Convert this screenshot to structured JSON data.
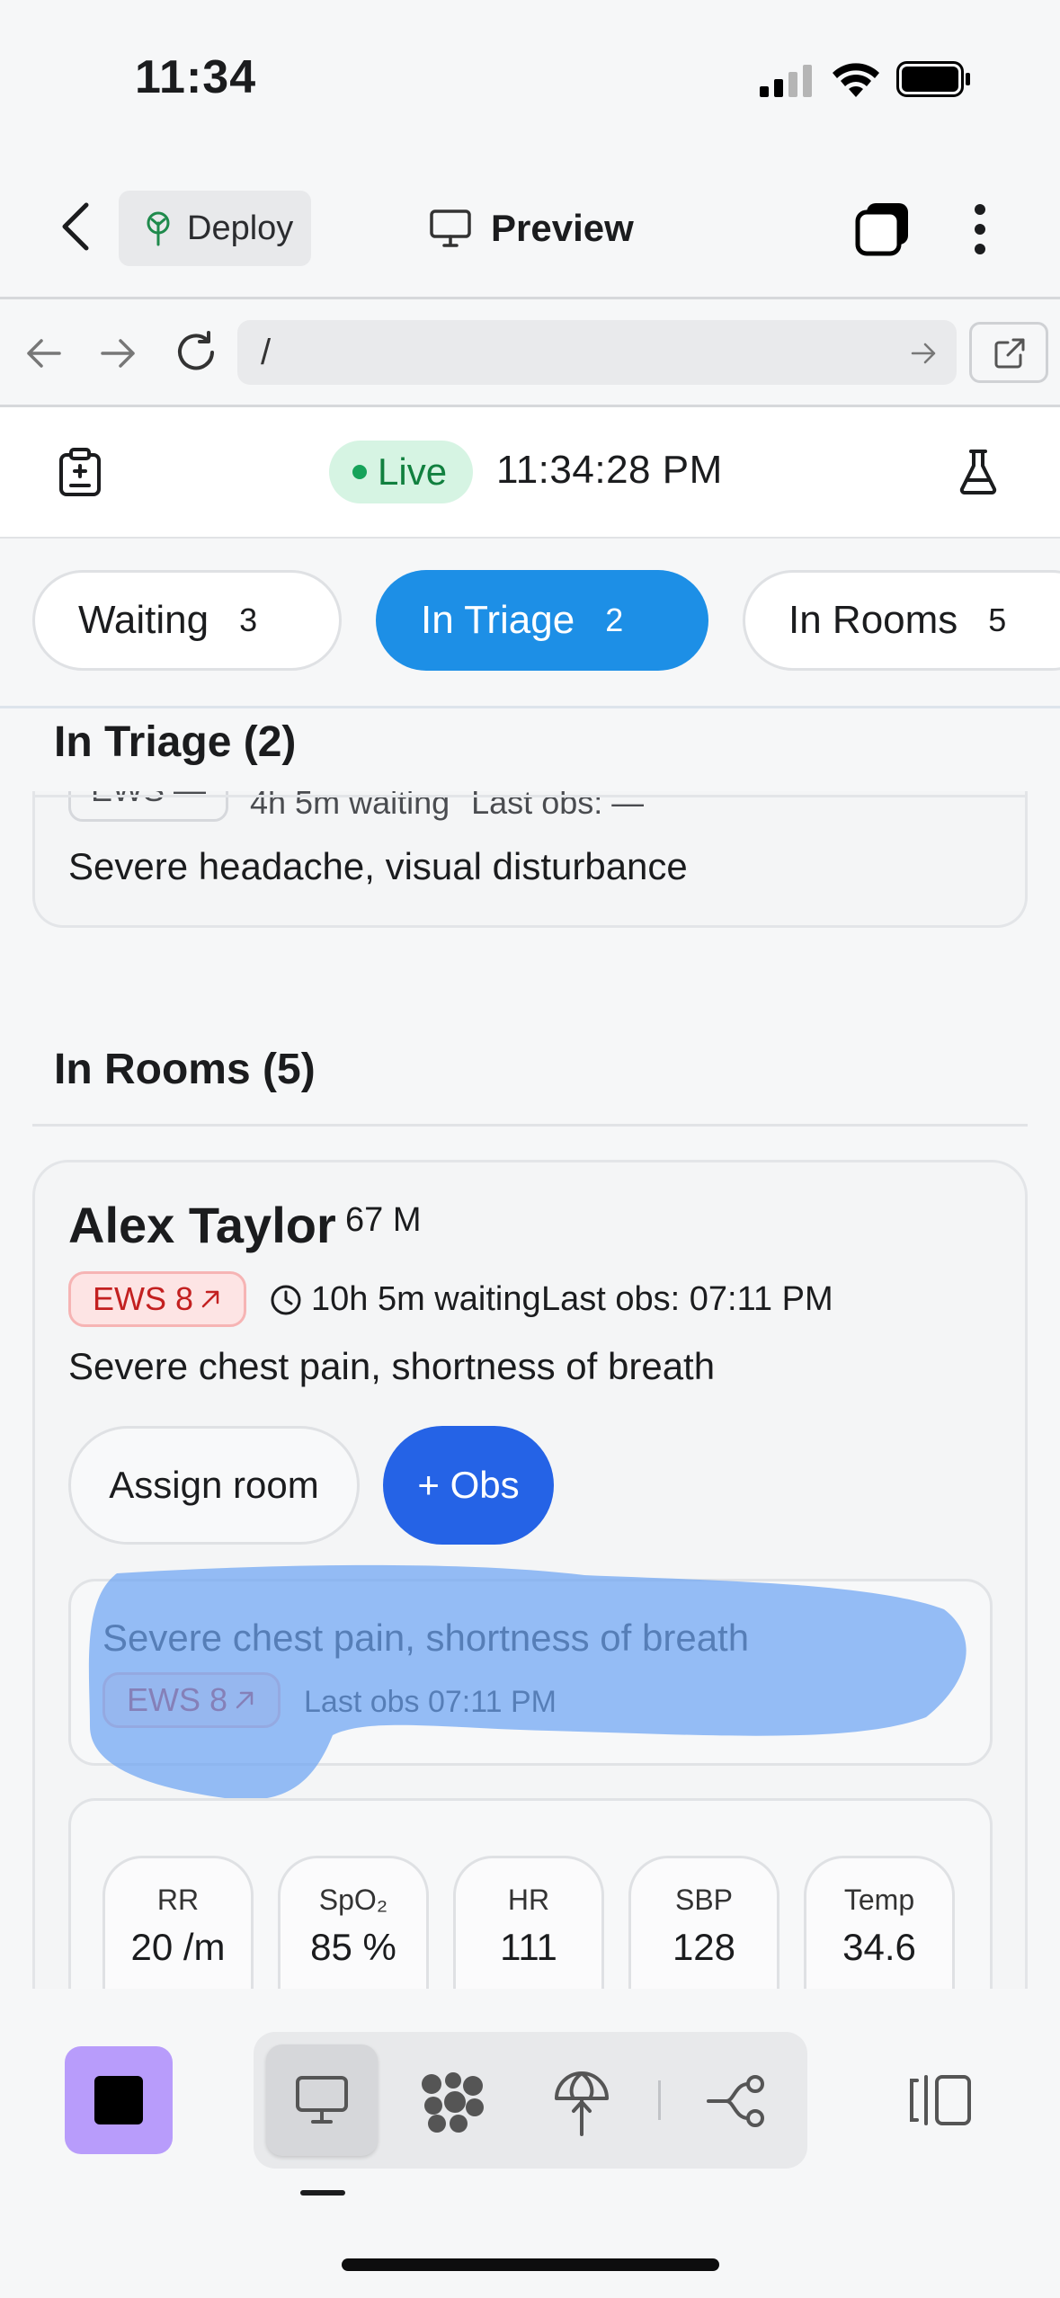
{
  "status_bar": {
    "time": "11:34"
  },
  "top_bar": {
    "deploy_label": "Deploy",
    "preview_label": "Preview"
  },
  "browser": {
    "url": "/"
  },
  "app_header": {
    "live_label": "Live",
    "clock": "11:34:28 PM"
  },
  "tabs": [
    {
      "label": "Waiting",
      "count": "3",
      "active": false
    },
    {
      "label": "In Triage",
      "count": "2",
      "active": true
    },
    {
      "label": "In Rooms",
      "count": "5",
      "active": false
    }
  ],
  "triage_section": {
    "title": "In Triage (2)",
    "partial_card": {
      "ews": "EWS —",
      "waiting": "4h 5m waiting",
      "last_obs": "Last obs: —",
      "complaint": "Severe headache, visual disturbance"
    }
  },
  "rooms_section": {
    "title": "In Rooms (5)",
    "patient": {
      "name": "Alex Taylor",
      "age_sex": "67 M",
      "ews": "EWS 8",
      "waiting": "10h 5m waiting",
      "last_obs": "Last obs: 07:11 PM",
      "complaint": "Severe chest pain, shortness of breath",
      "assign_label": "Assign room",
      "obs_label": "+ Obs",
      "summary": {
        "complaint": "Severe chest pain, shortness of breath",
        "ews": "EWS 8",
        "last_obs": "Last obs 07:11 PM"
      },
      "vitals": [
        {
          "label": "RR",
          "value": "20 /m"
        },
        {
          "label": "SpO₂",
          "value": "85 %"
        },
        {
          "label": "HR",
          "value": "111"
        },
        {
          "label": "SBP",
          "value": "128"
        },
        {
          "label": "Temp",
          "value": "34.6"
        }
      ]
    }
  },
  "colors": {
    "accent_blue": "#1d8fe6",
    "obs_button": "#2563e6",
    "ews_red": "#c32020",
    "live_green": "#11803f",
    "stop_purple": "#b89cfb",
    "highlight": "#6ea5f2"
  },
  "icons": [
    "back-chevron-icon",
    "deploy-tree-icon",
    "monitor-icon",
    "tabs-icon",
    "kebab-icon",
    "clipboard-icon",
    "flask-icon",
    "clock-icon",
    "arrow-up-right-icon",
    "layers-icon",
    "globe-arrow-icon",
    "branch-icon",
    "side-panel-icon"
  ]
}
